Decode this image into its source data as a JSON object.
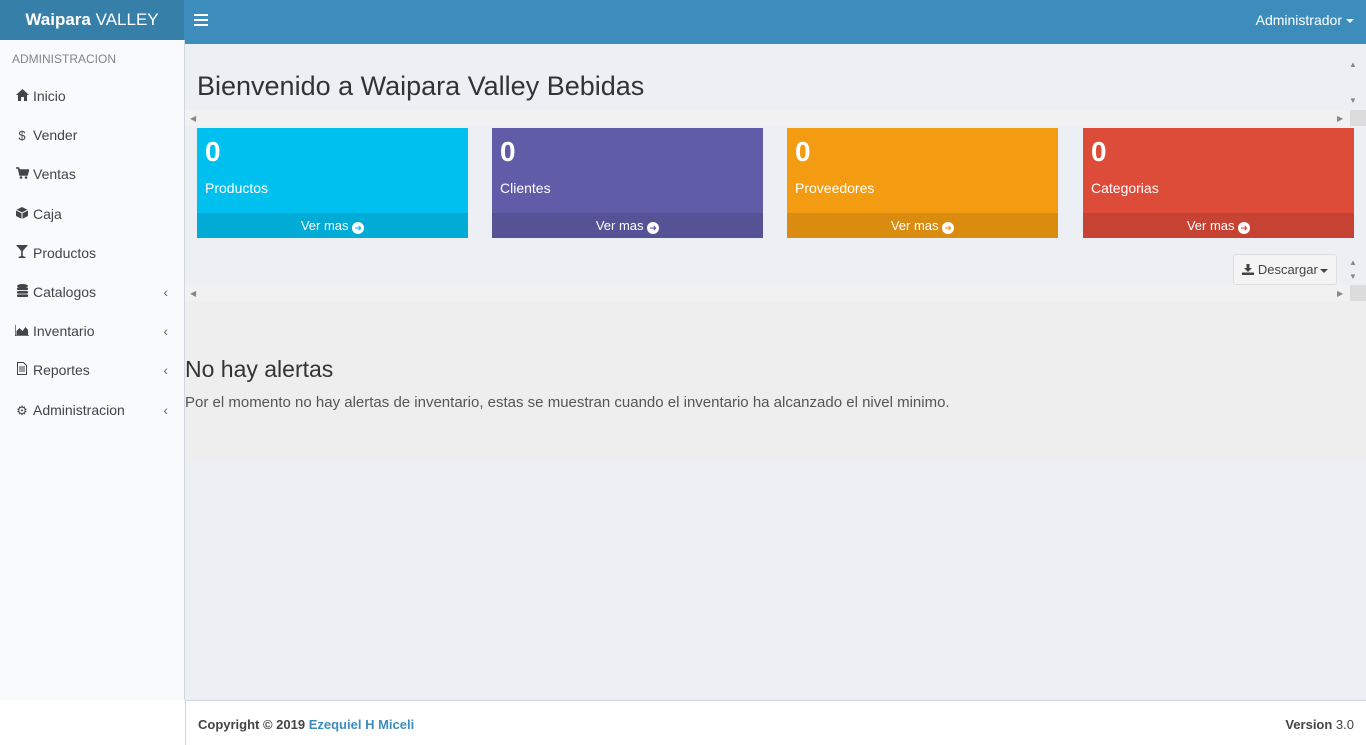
{
  "header": {
    "logo_bold": "Waipara",
    "logo_rest": " VALLEY",
    "user_label": "Administrador"
  },
  "sidebar": {
    "section_label": "ADMINISTRACION",
    "items": [
      {
        "label": "Inicio",
        "icon": "home-icon",
        "submenu": false
      },
      {
        "label": "Vender",
        "icon": "dollar-icon",
        "submenu": false
      },
      {
        "label": "Ventas",
        "icon": "cart-icon",
        "submenu": false
      },
      {
        "label": "Caja",
        "icon": "cube-icon",
        "submenu": false
      },
      {
        "label": "Productos",
        "icon": "glass-icon",
        "submenu": false
      },
      {
        "label": "Catalogos",
        "icon": "database-icon",
        "submenu": true
      },
      {
        "label": "Inventario",
        "icon": "area-chart-icon",
        "submenu": true
      },
      {
        "label": "Reportes",
        "icon": "file-text-icon",
        "submenu": true
      },
      {
        "label": "Administracion",
        "icon": "gear-icon",
        "submenu": true
      }
    ]
  },
  "main": {
    "title": "Bienvenido a Waipara Valley Bebidas",
    "boxes": [
      {
        "value": "0",
        "label": "Productos",
        "link": "Ver mas",
        "color": "#00c0ef"
      },
      {
        "value": "0",
        "label": "Clientes",
        "link": "Ver mas",
        "color": "#605ca8"
      },
      {
        "value": "0",
        "label": "Proveedores",
        "link": "Ver mas",
        "color": "#f39c12"
      },
      {
        "value": "0",
        "label": "Categorias",
        "link": "Ver mas",
        "color": "#dd4b39"
      }
    ],
    "download_label": "Descargar",
    "alerts_title": "No hay alertas",
    "alerts_text": "Por el momento no hay alertas de inventario, estas se muestran cuando el inventario ha alcanzado el nivel minimo."
  },
  "footer": {
    "copyright_prefix": "Copyright © 2019 ",
    "author": "Ezequiel H Miceli",
    "version_label": "Version",
    "version_value": " 3.0"
  }
}
